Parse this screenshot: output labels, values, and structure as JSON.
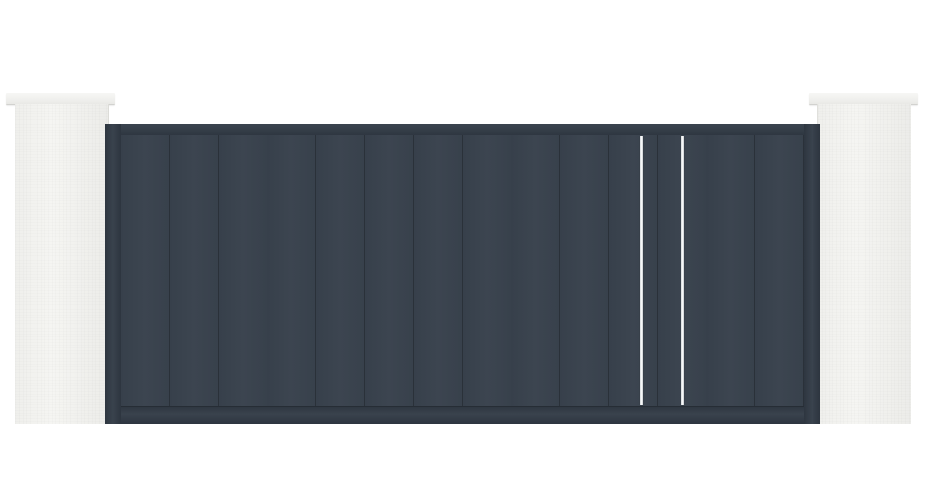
{
  "scene": {
    "subject": "sliding-gate",
    "colors": {
      "background": "#ffffff",
      "pillar": "#f1f1ee",
      "gate_panel": "#3a434e",
      "gate_frame": "#323a44",
      "insert": "#f4f5f6"
    },
    "boards": 14,
    "inserts": 2
  }
}
